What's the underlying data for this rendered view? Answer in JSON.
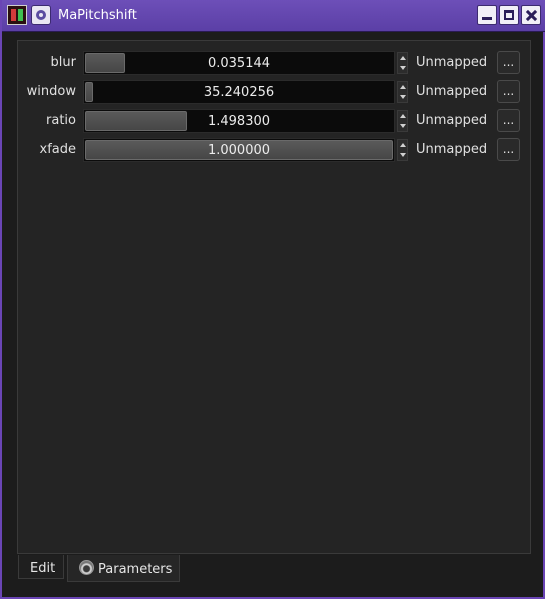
{
  "window": {
    "title": "MaPitchshift",
    "app_icon": "app-icon",
    "menu_icon": "window-menu-icon"
  },
  "params": [
    {
      "name": "blur",
      "value": "0.035144",
      "level": 0.13,
      "mapping": "Unmapped",
      "more": "..."
    },
    {
      "name": "window",
      "value": "35.240256",
      "level": 0.02,
      "mapping": "Unmapped",
      "more": "..."
    },
    {
      "name": "ratio",
      "value": "1.498300",
      "level": 0.33,
      "mapping": "Unmapped",
      "more": "..."
    },
    {
      "name": "xfade",
      "value": "1.000000",
      "level": 1.0,
      "mapping": "Unmapped",
      "more": "..."
    }
  ],
  "tabs": [
    {
      "label": "Edit",
      "active": false
    },
    {
      "label": "Parameters",
      "active": true,
      "icon": "parameters-icon"
    }
  ],
  "colors": {
    "titlebar": "#5b3fa6",
    "panel": "#242424",
    "slider_fill": "#4e4e4e"
  }
}
